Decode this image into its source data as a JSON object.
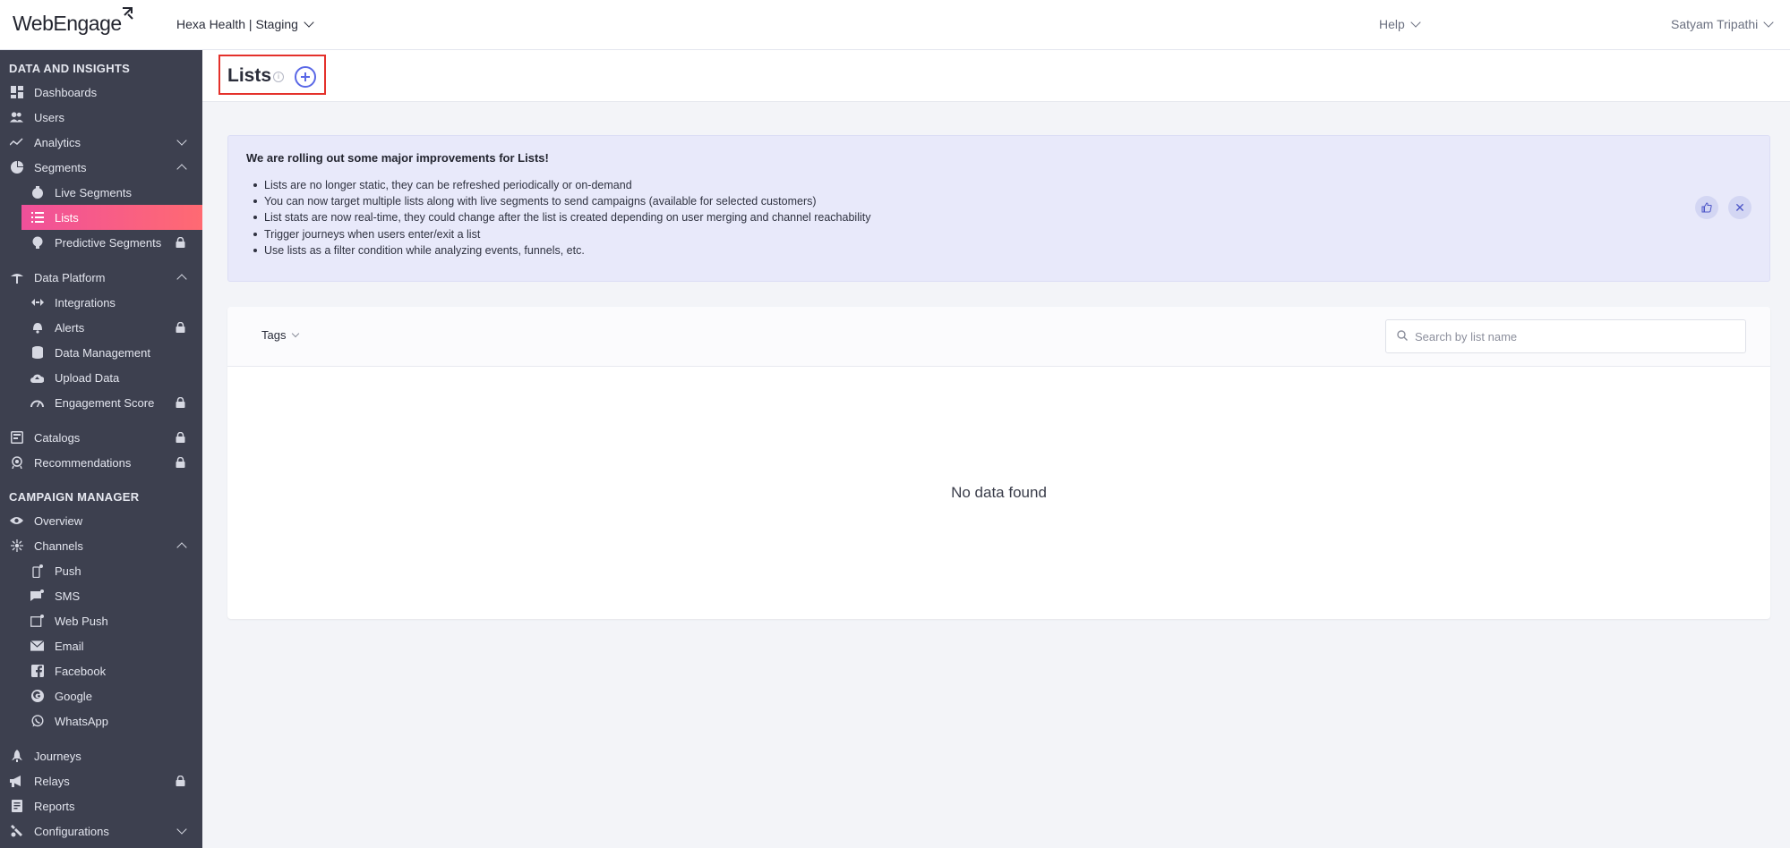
{
  "app": {
    "logo": "WebEngage"
  },
  "topbar": {
    "project": "Hexa Health | Staging",
    "help": "Help",
    "user": "Satyam Tripathi"
  },
  "sidebar": {
    "section1": "DATA AND INSIGHTS",
    "dashboards": "Dashboards",
    "users": "Users",
    "analytics": "Analytics",
    "segments": "Segments",
    "live_segments": "Live Segments",
    "lists": "Lists",
    "predictive_segments": "Predictive Segments",
    "data_platform": "Data Platform",
    "integrations": "Integrations",
    "alerts": "Alerts",
    "data_management": "Data Management",
    "upload_data": "Upload Data",
    "engagement_score": "Engagement Score",
    "catalogs": "Catalogs",
    "recommendations": "Recommendations",
    "section2": "CAMPAIGN MANAGER",
    "overview": "Overview",
    "channels": "Channels",
    "push": "Push",
    "sms": "SMS",
    "web_push": "Web Push",
    "email": "Email",
    "facebook": "Facebook",
    "google": "Google",
    "whatsapp": "WhatsApp",
    "journeys": "Journeys",
    "relays": "Relays",
    "reports": "Reports",
    "configurations": "Configurations"
  },
  "page": {
    "title": "Lists",
    "info_glyph": "i"
  },
  "banner": {
    "title": "We are rolling out some major improvements for Lists!",
    "items": [
      "Lists are no longer static, they can be refreshed periodically or on-demand",
      "You can now target multiple lists along with live segments to send campaigns (available for selected customers)",
      "List stats are now real-time, they could change after the list is created depending on user merging and channel reachability",
      "Trigger journeys when users enter/exit a list",
      "Use lists as a filter condition while analyzing events, funnels, etc."
    ],
    "close_glyph": "✕"
  },
  "list_panel": {
    "tags_label": "Tags",
    "search_placeholder": "Search by list name",
    "empty_message": "No data found"
  },
  "colors": {
    "sidebar_bg": "#3d404f",
    "active_gradient_start": "#f0509a",
    "active_gradient_end": "#ff6a72",
    "accent": "#5a68e6",
    "highlight_box": "#e4312b",
    "banner_bg": "#e8e9fa"
  },
  "icons": {
    "add": "plus-circle-icon",
    "info": "info-icon",
    "search": "search-icon",
    "like": "thumbs-up-icon",
    "close": "close-icon",
    "lock": "lock-icon"
  }
}
